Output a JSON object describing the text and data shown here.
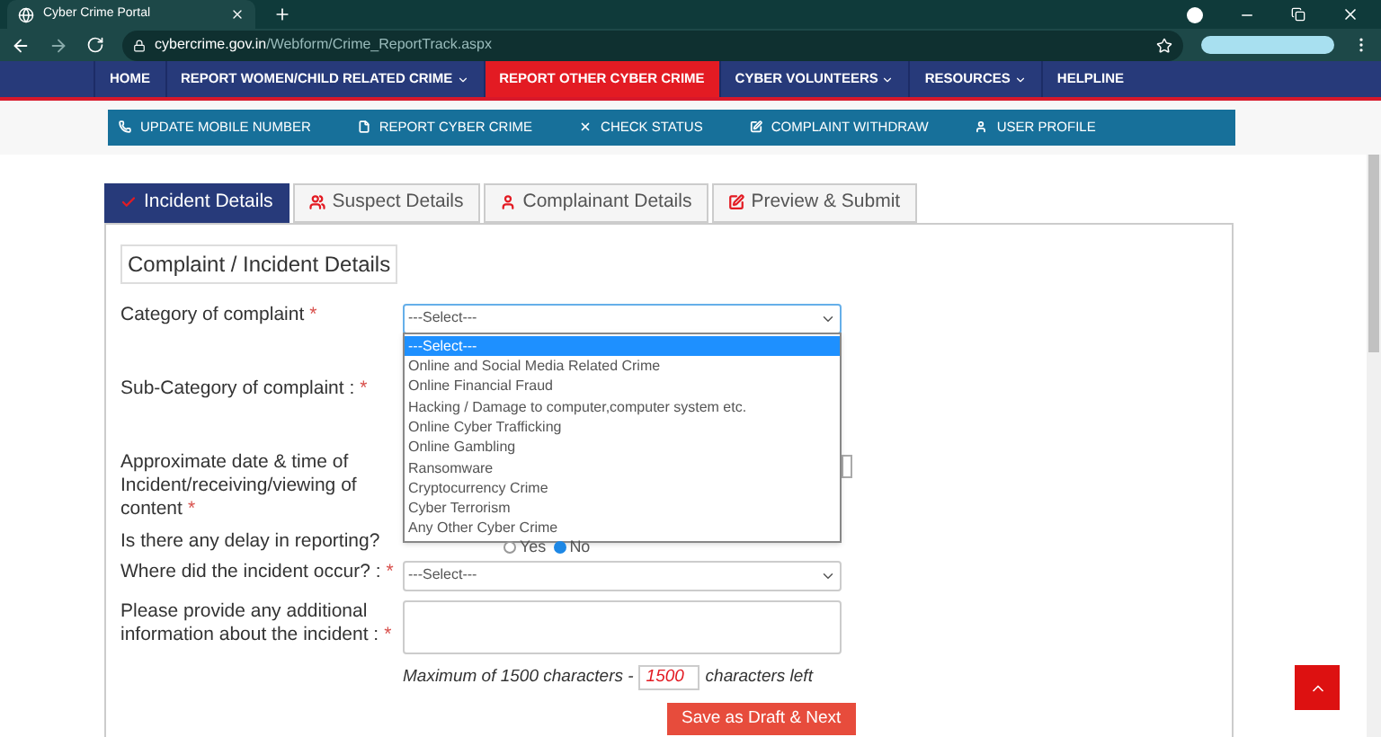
{
  "browser": {
    "tab_title": "Cyber Crime Portal",
    "url_host": "cybercrime.gov.in",
    "url_path": "/Webform/Crime_ReportTrack.aspx"
  },
  "nav": [
    {
      "label": "HOME",
      "dropdown": false,
      "selected": false
    },
    {
      "label": "REPORT WOMEN/CHILD RELATED CRIME",
      "dropdown": true,
      "selected": false
    },
    {
      "label": "REPORT OTHER CYBER CRIME",
      "dropdown": false,
      "selected": true
    },
    {
      "label": "CYBER VOLUNTEERS",
      "dropdown": true,
      "selected": false
    },
    {
      "label": "RESOURCES",
      "dropdown": true,
      "selected": false
    },
    {
      "label": "HELPLINE",
      "dropdown": false,
      "selected": false
    }
  ],
  "subnav": [
    {
      "label": "UPDATE MOBILE NUMBER",
      "kind": "phone"
    },
    {
      "label": "REPORT CYBER CRIME",
      "kind": "file"
    },
    {
      "label": "CHECK STATUS",
      "kind": "cross"
    },
    {
      "label": "COMPLAINT WITHDRAW",
      "kind": "edit"
    },
    {
      "label": "USER PROFILE",
      "kind": "user"
    }
  ],
  "tabs": [
    {
      "label": "Incident Details",
      "kind": "check",
      "selected": true
    },
    {
      "label": "Suspect Details",
      "kind": "users",
      "selected": false
    },
    {
      "label": "Complainant Details",
      "kind": "user",
      "selected": false
    },
    {
      "label": "Preview & Submit",
      "kind": "edit",
      "selected": false
    }
  ],
  "section_title": "Complaint / Incident Details",
  "fields": [
    {
      "kind": "select",
      "label": "Category of complaint",
      "mark": "*",
      "value": "---Select---",
      "expanded": true,
      "options": [
        {
          "label": "---Select---",
          "selected": true
        },
        {
          "label": "Online and Social Media Related Crime",
          "selected": false
        },
        {
          "label": "Online Financial Fraud",
          "selected": false
        },
        {
          "label": "Hacking / Damage to computer,computer system etc.",
          "selected": false
        },
        {
          "label": "Online Cyber Trafficking",
          "selected": false
        },
        {
          "label": "Online Gambling",
          "selected": false
        },
        {
          "label": "Ransomware",
          "selected": false
        },
        {
          "label": "Cryptocurrency Crime",
          "selected": false
        },
        {
          "label": "Cyber Terrorism",
          "selected": false
        },
        {
          "label": "Any Other Cyber Crime",
          "selected": false
        }
      ]
    },
    {
      "kind": "blank",
      "label": "Sub-Category of complaint :",
      "mark": "*"
    },
    {
      "kind": "datetime",
      "label": "Approximate date & time of Incident/receiving/viewing of content",
      "mark": "*"
    },
    {
      "kind": "radio",
      "label": "Is there any delay in reporting?",
      "options": [
        {
          "label": "Yes",
          "selected": false
        },
        {
          "label": "No",
          "selected": true
        }
      ]
    },
    {
      "kind": "select",
      "label": "Where did the incident occur? :",
      "mark": "*",
      "value": "---Select---",
      "expanded": false
    },
    {
      "kind": "textarea",
      "label": "Please provide any additional information about the incident :",
      "mark": "*"
    }
  ],
  "counter": {
    "prefix": "Maximum of 1500 characters -",
    "value": "1500",
    "suffix": "characters left"
  },
  "submit": "Save as Draft & Next"
}
